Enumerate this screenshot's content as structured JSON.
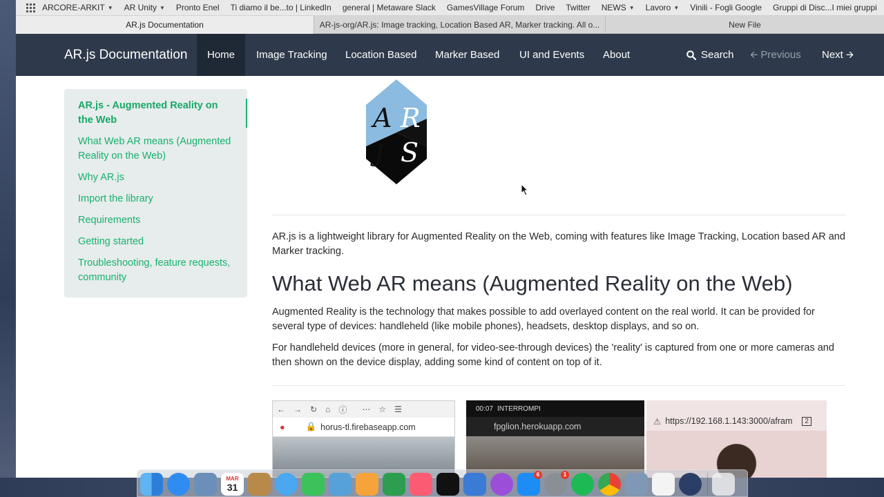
{
  "bookmarks": {
    "items": [
      {
        "label": "ARCORE-ARKIT",
        "dropdown": true
      },
      {
        "label": "AR Unity",
        "dropdown": true
      },
      {
        "label": "Pronto Enel",
        "dropdown": false
      },
      {
        "label": "Ti diamo il be...to | LinkedIn",
        "dropdown": false
      },
      {
        "label": "general | Metaware Slack",
        "dropdown": false
      },
      {
        "label": "GamesVillage Forum",
        "dropdown": false
      },
      {
        "label": "Drive",
        "dropdown": false
      },
      {
        "label": "Twitter",
        "dropdown": false
      },
      {
        "label": "NEWS",
        "dropdown": true
      },
      {
        "label": "Lavoro",
        "dropdown": true
      },
      {
        "label": "Vinili - Fogli Google",
        "dropdown": false
      },
      {
        "label": "Gruppi di Disc...I miei gruppi",
        "dropdown": false
      }
    ]
  },
  "tabs": [
    {
      "label": "AR.js Documentation",
      "active": true
    },
    {
      "label": "AR-js-org/AR.js: Image tracking, Location Based AR, Marker tracking. All o...",
      "active": false
    },
    {
      "label": "New File",
      "active": false
    }
  ],
  "navbar": {
    "brand": "AR.js Documentation",
    "links": [
      "Home",
      "Image Tracking",
      "Location Based",
      "Marker Based",
      "UI and Events",
      "About"
    ],
    "active_link": "Home",
    "search": "Search",
    "previous": "Previous",
    "next": "Next"
  },
  "sidebar": {
    "items": [
      "AR.js - Augmented Reality on the Web",
      "What Web AR means (Augmented Reality on the Web)",
      "Why AR.js",
      "Import the library",
      "Requirements",
      "Getting started",
      "Troubleshooting, feature requests, community"
    ],
    "active_index": 0
  },
  "content": {
    "logo_text": "ARjs",
    "intro": "AR.js is a lightweight library for Augmented Reality on the Web, coming with features like Image Tracking, Location based AR and Marker tracking.",
    "heading": "What Web AR means (Augmented Reality on the Web)",
    "para1": "Augmented Reality is the technology that makes possible to add overlayed content on the real world. It can be provided for several type of devices: handleheld (like mobile phones), headsets, desktop displays, and so on.",
    "para2": "For handleheld devices (more in general, for video-see-through devices) the 'reality' is captured from one or more cameras and then shown on the device display, adding some kind of content on top of it.",
    "screenshots": {
      "shot1_url": "horus-tl.firebaseapp.com",
      "shot2_time": "00:07",
      "shot2_label": "INTERROMPI",
      "shot2_url": "fpglion.herokuapp.com",
      "shot3_url": "https://192.168.1.143:3000/afram",
      "shot3_tabs": "2"
    }
  },
  "dock": {
    "calendar_month": "MAR",
    "calendar_day": "31",
    "badges": {
      "appstore": "6",
      "settings": "1"
    }
  },
  "colors": {
    "navbar": "#2e3a4b",
    "accent_green": "#17b26e",
    "sidebar_bg": "#e7ecec"
  }
}
